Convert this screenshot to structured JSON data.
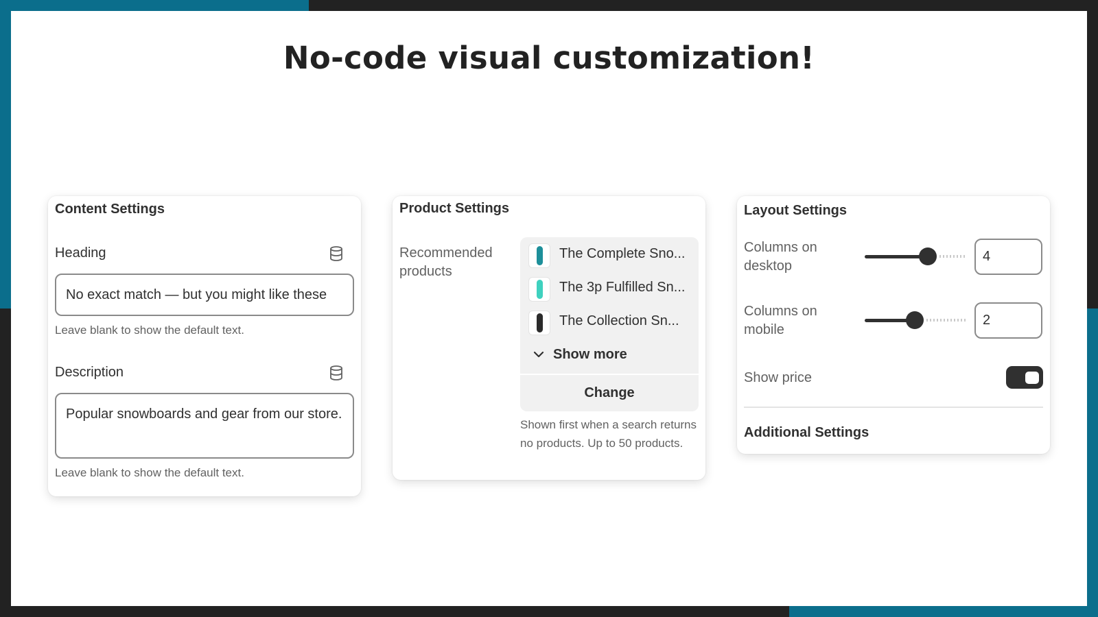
{
  "colors": {
    "frame_dark": "#222222",
    "accent_teal": "#0b6e8c",
    "canvas": "#ffffff",
    "control_dark": "#303030"
  },
  "headline": "No-code visual customization!",
  "content_settings": {
    "title": "Content Settings",
    "heading": {
      "label": "Heading",
      "icon": "database-icon",
      "value": "No exact match — but you might like these",
      "help": "Leave blank to show the default text."
    },
    "description": {
      "label": "Description",
      "icon": "database-icon",
      "value": "Popular snowboards and gear from our store.",
      "help": "Leave blank to show the default text."
    }
  },
  "product_settings": {
    "title": "Product Settings",
    "recommended_label": "Recommended products",
    "products": [
      {
        "name": "The Complete Sno...",
        "board_color": "#1d8f9a"
      },
      {
        "name": "The 3p Fulfilled Sn...",
        "board_color": "#3fd1bf"
      },
      {
        "name": "The Collection Sn...",
        "board_color": "#2b2b2b"
      }
    ],
    "show_more_label": "Show more",
    "change_label": "Change",
    "help": "Shown first when a search returns no products. Up to 50 products."
  },
  "layout_settings": {
    "title": "Layout Settings",
    "columns_desktop": {
      "label": "Columns on desktop",
      "value": "4",
      "slider_fraction": 0.62
    },
    "columns_mobile": {
      "label": "Columns on mobile",
      "value": "2",
      "slider_fraction": 0.49
    },
    "show_price": {
      "label": "Show price",
      "enabled": true
    },
    "additional_settings_label": "Additional Settings"
  }
}
